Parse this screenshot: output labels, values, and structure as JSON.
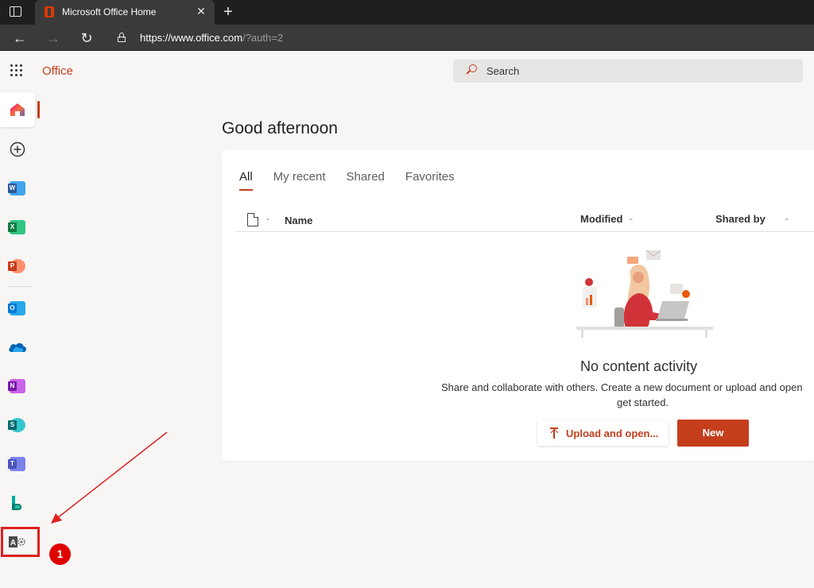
{
  "browser": {
    "tab_title": "Microsoft Office Home",
    "tab_close": "✕",
    "new_tab": "+",
    "url_host": "https://www.office.com",
    "url_path": "/?auth=2"
  },
  "header": {
    "app_name": "Office",
    "search_placeholder": "Search"
  },
  "rail": {
    "items": [
      {
        "name": "home-icon",
        "label": "Home",
        "color": "#c43e1c"
      },
      {
        "name": "create-icon",
        "label": "Create"
      },
      {
        "name": "word-icon",
        "letter": "W",
        "color": "#2b579a"
      },
      {
        "name": "excel-icon",
        "letter": "X",
        "color": "#217346"
      },
      {
        "name": "powerpoint-icon",
        "letter": "P",
        "color": "#d24726"
      },
      {
        "name": "outlook-icon",
        "letter": "O",
        "color": "#0072c6"
      },
      {
        "name": "onedrive-icon",
        "color": "#0364b8"
      },
      {
        "name": "onenote-icon",
        "letter": "N",
        "color": "#7719aa"
      },
      {
        "name": "sharepoint-icon",
        "letter": "S",
        "color": "#038387"
      },
      {
        "name": "teams-icon",
        "letter": "T",
        "color": "#5059c9"
      },
      {
        "name": "bookings-icon",
        "color": "#00a99d"
      },
      {
        "name": "admin-icon",
        "letter": "A",
        "color": "#555555"
      }
    ]
  },
  "main": {
    "greeting": "Good afternoon",
    "tabs": [
      {
        "label": "All",
        "active": true
      },
      {
        "label": "My recent"
      },
      {
        "label": "Shared"
      },
      {
        "label": "Favorites"
      }
    ],
    "columns": {
      "name": "Name",
      "modified": "Modified",
      "shared_by": "Shared by"
    },
    "empty_state": {
      "title": "No content activity",
      "description_line1": "Share and collaborate with others. Create a new document or upload and open",
      "description_line2": "get started."
    },
    "buttons": {
      "upload": "Upload and open...",
      "new": "New"
    }
  },
  "annotation": {
    "step_number": "1",
    "color": "#e00000"
  }
}
